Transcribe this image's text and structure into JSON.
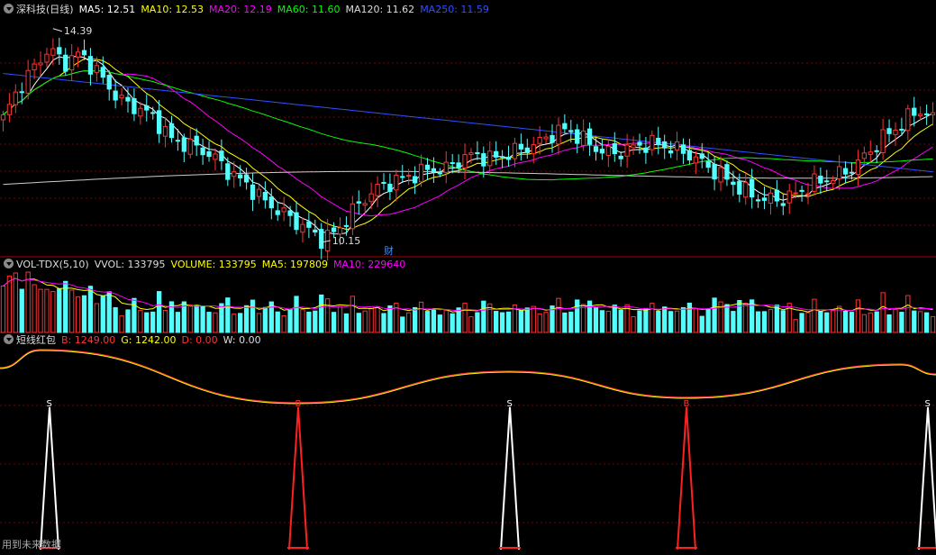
{
  "chart_data": [
    {
      "type": "candlestick",
      "panel": "main",
      "title": "深科技(日线)",
      "indicators": [
        {
          "label": "MA5: 12.51",
          "color": "#ffffff"
        },
        {
          "label": "MA10: 12.53",
          "color": "#ffff00"
        },
        {
          "label": "MA20: 12.19",
          "color": "#ff00ff"
        },
        {
          "label": "MA60: 11.60",
          "color": "#00ff00"
        },
        {
          "label": "MA120: 11.62",
          "color": "#dddddd"
        },
        {
          "label": "MA250: 11.59",
          "color": "#3050ff"
        }
      ],
      "annotations": {
        "high_label": "14.39",
        "low_label": "10.15",
        "event_marker": "财"
      },
      "ylim": [
        9.9,
        14.6
      ],
      "high": 14.39,
      "low": 10.15,
      "close_path": [
        12.6,
        13.2,
        13.6,
        14.0,
        13.7,
        13.9,
        13.6,
        13.2,
        12.9,
        12.8,
        12.6,
        12.2,
        12.1,
        12.0,
        11.8,
        11.5,
        11.3,
        11.0,
        10.8,
        10.6,
        10.4,
        10.2,
        10.4,
        10.8,
        11.1,
        11.3,
        11.4,
        11.5,
        11.6,
        11.6,
        11.8,
        11.9,
        11.8,
        11.9,
        12.0,
        12.1,
        12.3,
        12.4,
        12.2,
        12.0,
        11.9,
        12.0,
        12.1,
        12.1,
        12.0,
        11.9,
        11.7,
        11.5,
        11.3,
        11.1,
        11.0,
        11.0,
        11.1,
        11.3,
        11.4,
        11.5,
        11.7,
        12.0,
        12.3,
        12.5,
        12.8,
        12.6
      ],
      "volume_panel": {
        "legend": [
          {
            "label": "VOL-TDX(5,10)",
            "color": "#dddddd"
          },
          {
            "label": "VVOL: 133795",
            "color": "#dddddd"
          },
          {
            "label": "VOLUME: 133795",
            "color": "#ffff00"
          },
          {
            "label": "MA5: 197809",
            "color": "#ffff00"
          },
          {
            "label": "MA10: 229640",
            "color": "#ff00ff"
          }
        ]
      },
      "indicator_panel": {
        "legend": [
          {
            "label": "短线红包",
            "color": "#dddddd"
          },
          {
            "label": "B: 1249.00",
            "color": "#ff3333"
          },
          {
            "label": "G: 1242.00",
            "color": "#ffff00"
          },
          {
            "label": "D: 0.00",
            "color": "#ff3333"
          },
          {
            "label": "W: 0.00",
            "color": "#dddddd"
          }
        ],
        "signals": [
          {
            "label": "S",
            "type": "sell"
          },
          {
            "label": "B",
            "type": "buy"
          },
          {
            "label": "S",
            "type": "sell"
          },
          {
            "label": "B",
            "type": "buy"
          },
          {
            "label": "S",
            "type": "sell"
          }
        ]
      }
    }
  ],
  "footer_note": "用到未来数据",
  "colors": {
    "up": "#ff3232",
    "down": "#54fcfc",
    "grid": "#7a0000",
    "separator": "#b00000"
  }
}
